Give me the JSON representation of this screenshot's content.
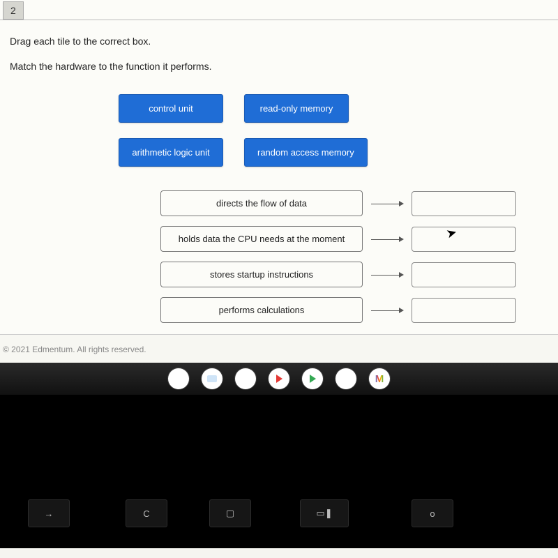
{
  "question_number": "2",
  "instruction_line_1": "Drag each tile to the correct box.",
  "instruction_line_2": "Match the hardware to the function it performs.",
  "tiles": {
    "t0": "control unit",
    "t1": "read-only memory",
    "t2": "arithmetic logic unit",
    "t3": "random access memory"
  },
  "prompts": {
    "p0": "directs the flow of data",
    "p1": "holds data the CPU needs at the moment",
    "p2": "stores startup instructions",
    "p3": "performs calculations"
  },
  "copyright": "© 2021 Edmentum. All rights reserved.",
  "shelf": {
    "chrome": "chrome-icon",
    "files": "files-icon",
    "docs": "docs-icon",
    "youtube": "youtube-icon",
    "play": "play-store-icon",
    "messages": "messages-icon",
    "gmail": "gmail-icon",
    "gmail_letter": "M"
  },
  "keys": {
    "arrow": "→",
    "refresh": "C",
    "square": "▢",
    "overview": "▭❚",
    "dot": "o"
  }
}
